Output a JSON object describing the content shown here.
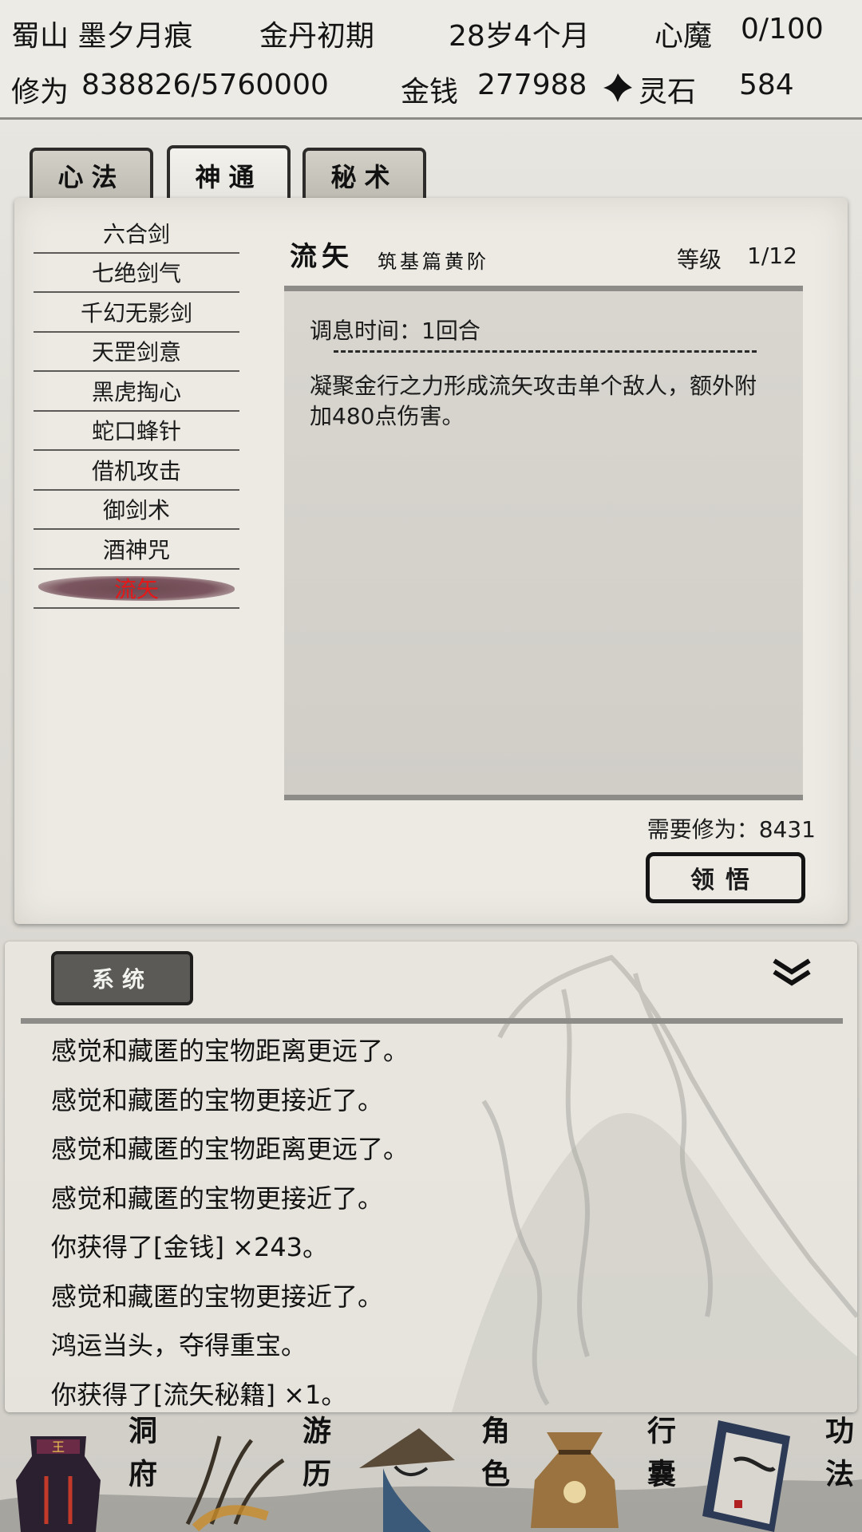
{
  "status": {
    "sect_name": "蜀山 墨夕月痕",
    "realm": "金丹初期",
    "age": "28岁4个月",
    "heart_demon_label": "心魔",
    "heart_demon_value": "0/100",
    "cultivation_label": "修为",
    "cultivation_value": "838826/5760000",
    "money_label": "金钱",
    "money_value": "277988",
    "spirit_stone_label": "灵石",
    "spirit_stone_value": "584",
    "spirit_stone_icon": "spirit-stone-icon"
  },
  "tabs": [
    {
      "label": "心法",
      "active": false
    },
    {
      "label": "神通",
      "active": true
    },
    {
      "label": "秘术",
      "active": false
    }
  ],
  "skills": [
    "六合剑",
    "七绝剑气",
    "千幻无影剑",
    "天罡剑意",
    "黑虎掏心",
    "蛇口蜂针",
    "借机攻击",
    "御剑术",
    "酒神咒",
    "流矢"
  ],
  "selected_skill_index": 9,
  "detail": {
    "title": "流矢",
    "subtitle": "筑基篇黄阶",
    "level_label": "等级",
    "level_value": "1/12",
    "rest_time": "调息时间：1回合",
    "description": "凝聚金行之力形成流矢攻击单个敌人，额外附加480点伤害。",
    "requirement": "需要修为：8431",
    "button_label": "领悟"
  },
  "log": {
    "tab_label": "系统",
    "collapse_icon": "double-chevron-down-icon",
    "lines": [
      "感觉和藏匿的宝物距离更远了。",
      "感觉和藏匿的宝物更接近了。",
      "感觉和藏匿的宝物距离更远了。",
      "感觉和藏匿的宝物更接近了。",
      "你获得了[金钱] ×243。",
      "感觉和藏匿的宝物更接近了。",
      "鸿运当头，夺得重宝。",
      "你获得了[流矢秘籍] ×1。"
    ]
  },
  "nav": [
    {
      "label": "洞府",
      "icon": "cave-icon"
    },
    {
      "label": "游历",
      "icon": "travel-icon"
    },
    {
      "label": "角色",
      "icon": "character-icon"
    },
    {
      "label": "行囊",
      "icon": "bag-icon"
    },
    {
      "label": "功法",
      "icon": "book-icon"
    }
  ],
  "colors": {
    "selected_skill_text": "#e41818",
    "panel_bg": "#eceae3",
    "accent_dark": "#141414"
  }
}
